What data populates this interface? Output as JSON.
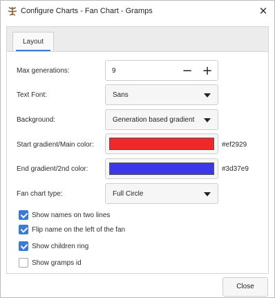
{
  "window": {
    "title": "Configure Charts - Fan Chart - Gramps",
    "close_glyph": "✕",
    "app_icon": "gramps-app-icon"
  },
  "tabs": [
    {
      "label": "Layout",
      "active": true
    }
  ],
  "layout": {
    "max_generations": {
      "label": "Max generations:",
      "value": "9",
      "decrement_glyph": "−",
      "increment_glyph": "+"
    },
    "text_font": {
      "label": "Text Font:",
      "value": "Sans"
    },
    "background": {
      "label": "Background:",
      "value": "Generation based gradient"
    },
    "start_gradient": {
      "label": "Start gradient/Main color:",
      "hex": "#ef2929",
      "color": "#ef2929"
    },
    "end_gradient": {
      "label": "End gradient/2nd color:",
      "hex": "#3d37e9",
      "color": "#3d37e9"
    },
    "fan_chart_type": {
      "label": "Fan chart type:",
      "value": "Full Circle"
    },
    "checkboxes": [
      {
        "label": "Show names on two lines",
        "checked": true
      },
      {
        "label": "Flip name on the left of the fan",
        "checked": true
      },
      {
        "label": "Show children ring",
        "checked": true
      },
      {
        "label": "Show gramps id",
        "checked": false
      }
    ]
  },
  "footer": {
    "close_label": "Close"
  },
  "colors": {
    "accent": "#3a7bd5"
  }
}
